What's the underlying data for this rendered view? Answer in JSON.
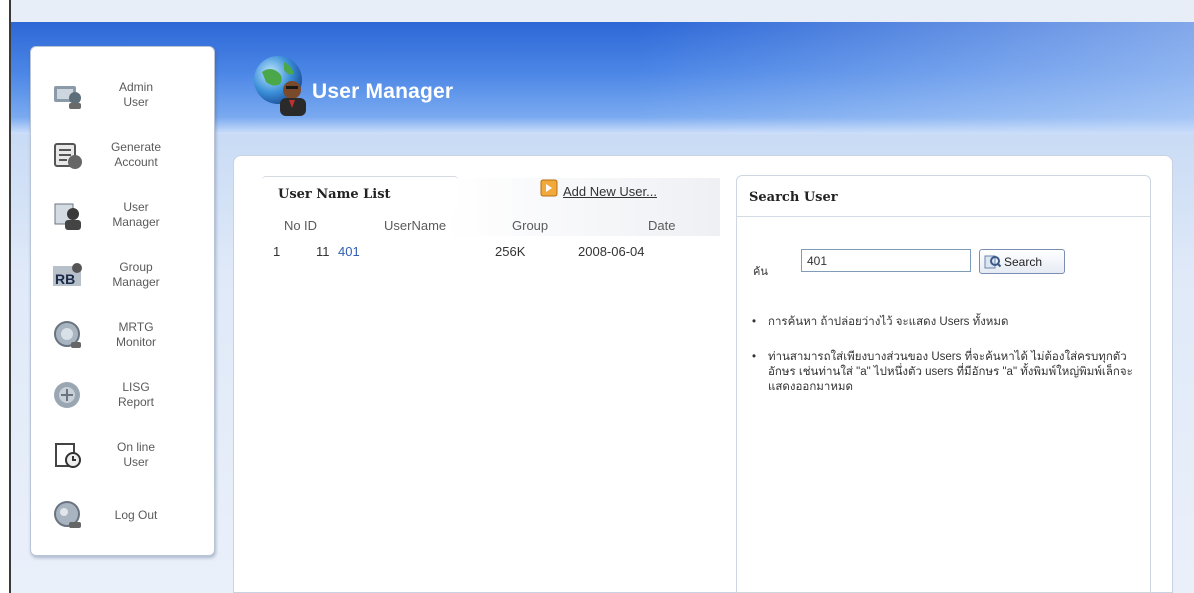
{
  "sidebar": {
    "items": [
      {
        "label": "Admin\nUser",
        "icon": "admin-user-icon"
      },
      {
        "label": "Generate\nAccount",
        "icon": "generate-account-icon"
      },
      {
        "label": "User\nManager",
        "icon": "user-manager-icon"
      },
      {
        "label": "Group\nManager",
        "icon": "group-manager-icon"
      },
      {
        "label": "MRTG\nMonitor",
        "icon": "mrtg-monitor-icon"
      },
      {
        "label": "LISG\nReport",
        "icon": "lisg-report-icon"
      },
      {
        "label": "On line\nUser",
        "icon": "online-user-icon"
      },
      {
        "label": "Log Out",
        "icon": "logout-icon"
      }
    ]
  },
  "header": {
    "title": "User Manager",
    "icon": "globe-user-icon"
  },
  "user_list": {
    "title": "User Name List",
    "add_link": "Add New User...",
    "columns": [
      "No",
      "ID",
      "UserName",
      "Group",
      "Date"
    ],
    "rows": [
      {
        "no": "1",
        "id": "11",
        "username": "401",
        "group": "256K",
        "date": "2008-06-04"
      }
    ]
  },
  "search": {
    "title": "Search User",
    "label": "ค้น",
    "value": "401",
    "button_label": "Search",
    "notes": [
      "การค้นหา ถ้าปล่อยว่างไว้ จะแสดง Users ทั้งหมด",
      "ท่านสามารถใส่เพียงบางส่วนของ Users ที่จะค้นหาได้ ไม่ต้องใส่ครบทุกตัวอักษร เช่นท่านใส่ \"a\" ไปหนึ่งตัว users ที่มีอักษร \"a\" ทั้งพิมพ์ใหญ่พิมพ์เล็กจะแสดงออกมาหมด"
    ]
  },
  "colors": {
    "banner": "#3b78e0",
    "link": "#2f5fb3"
  }
}
